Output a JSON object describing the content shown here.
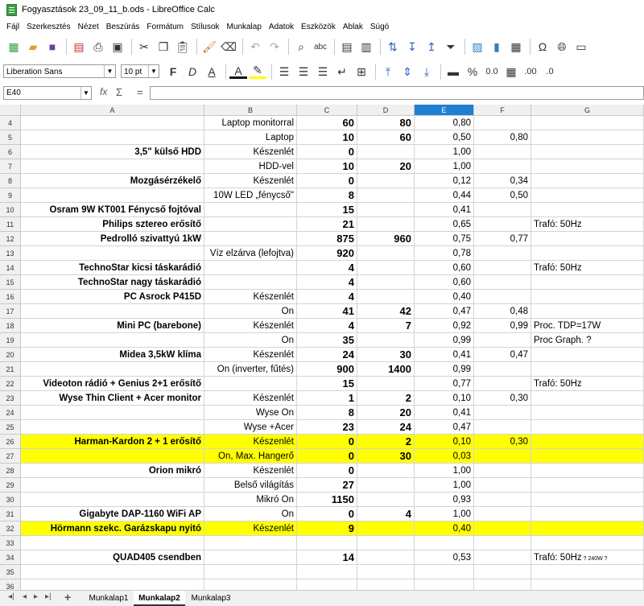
{
  "window": {
    "title": "Fogyasztások 23_09_11_b.ods - LibreOffice Calc"
  },
  "menu": [
    "Fájl",
    "Szerkesztés",
    "Nézet",
    "Beszúrás",
    "Formátum",
    "Stílusok",
    "Munkalap",
    "Adatok",
    "Eszközök",
    "Ablak",
    "Súgó"
  ],
  "format_toolbar": {
    "font_name": "Liberation Sans",
    "font_size": "10 pt"
  },
  "formula_bar": {
    "cell_ref": "E40",
    "value": ""
  },
  "columns": [
    "A",
    "B",
    "C",
    "D",
    "E",
    "F",
    "G"
  ],
  "selected_column": "E",
  "rows": [
    {
      "n": "4",
      "a": "",
      "b": "Laptop monitorral",
      "c": "60",
      "d": "80",
      "e": "0,80",
      "f": "",
      "g": ""
    },
    {
      "n": "5",
      "a": "",
      "b": "Laptop",
      "c": "10",
      "d": "60",
      "e": "0,50",
      "f": "0,80",
      "g": ""
    },
    {
      "n": "6",
      "a": "3,5\" külső HDD",
      "b": "Készenlét",
      "c": "0",
      "d": "",
      "e": "1,00",
      "f": "",
      "g": ""
    },
    {
      "n": "7",
      "a": "",
      "b": "HDD-vel",
      "c": "10",
      "d": "20",
      "e": "1,00",
      "f": "",
      "g": ""
    },
    {
      "n": "8",
      "a": "Mozgásérzékelő",
      "b": "Készenlét",
      "c": "0",
      "d": "",
      "e": "0,12",
      "f": "0,34",
      "g": ""
    },
    {
      "n": "9",
      "a": "",
      "b": "10W LED „fénycső\"",
      "c": "8",
      "d": "",
      "e": "0,44",
      "f": "0,50",
      "g": ""
    },
    {
      "n": "10",
      "a": "Osram 9W KT001 Fénycső fojtóval",
      "b": "",
      "c": "15",
      "d": "",
      "e": "0,41",
      "f": "",
      "g": ""
    },
    {
      "n": "11",
      "a": "Philips sztereo erősítő",
      "b": "",
      "c": "21",
      "d": "",
      "e": "0,65",
      "f": "",
      "g": "Trafó: 50Hz"
    },
    {
      "n": "12",
      "a": "Pedrolló szivattyú 1kW",
      "b": "",
      "c": "875",
      "d": "960",
      "e": "0,75",
      "f": "0,77",
      "g": ""
    },
    {
      "n": "13",
      "a": "",
      "b": "Víz elzárva (lefojtva)",
      "c": "920",
      "d": "",
      "e": "0,78",
      "f": "",
      "g": ""
    },
    {
      "n": "14",
      "a": "TechnoStar kicsi  táskarádió",
      "b": "",
      "c": "4",
      "d": "",
      "e": "0,60",
      "f": "",
      "g": "Trafó: 50Hz"
    },
    {
      "n": "15",
      "a": "TechnoStar nagy táskarádió",
      "b": "",
      "c": "4",
      "d": "",
      "e": "0,60",
      "f": "",
      "g": ""
    },
    {
      "n": "16",
      "a": "PC Asrock P415D",
      "b": "Készenlét",
      "c": "4",
      "d": "",
      "e": "0,40",
      "f": "",
      "g": ""
    },
    {
      "n": "17",
      "a": "",
      "b": "On",
      "c": "41",
      "d": "42",
      "e": "0,47",
      "f": "0,48",
      "g": ""
    },
    {
      "n": "18",
      "a": "Mini PC (barebone)",
      "b": "Készenlét",
      "c": "4",
      "d": "7",
      "e": "0,92",
      "f": "0,99",
      "g": "Proc. TDP=17W"
    },
    {
      "n": "19",
      "a": "",
      "b": "On",
      "c": "35",
      "d": "",
      "e": "0,99",
      "f": "",
      "g": "Proc Graph. ?"
    },
    {
      "n": "20",
      "a": "Midea 3,5kW klíma",
      "b": "Készenlét",
      "c": "24",
      "d": "30",
      "e": "0,41",
      "f": "0,47",
      "g": ""
    },
    {
      "n": "21",
      "a": "",
      "b": "On (inverter, fűtés)",
      "c": "900",
      "d": "1400",
      "e": "0,99",
      "f": "",
      "g": ""
    },
    {
      "n": "22",
      "a": "Videoton rádió + Genius 2+1 erősítő",
      "b": "",
      "c": "15",
      "d": "",
      "e": "0,77",
      "f": "",
      "g": "Trafó: 50Hz"
    },
    {
      "n": "23",
      "a": "Wyse Thin Client + Acer monitor",
      "b": "Készenlét",
      "c": "1",
      "d": "2",
      "e": "0,10",
      "f": "0,30",
      "g": ""
    },
    {
      "n": "24",
      "a": "",
      "b": "Wyse On",
      "c": "8",
      "d": "20",
      "e": "0,41",
      "f": "",
      "g": ""
    },
    {
      "n": "25",
      "a": "",
      "b": "Wyse +Acer",
      "c": "23",
      "d": "24",
      "e": "0,47",
      "f": "",
      "g": ""
    },
    {
      "n": "26",
      "a": "Harman-Kardon 2 + 1 erősítő",
      "b": "Készenlét",
      "c": "0",
      "d": "2",
      "e": "0,10",
      "f": "0,30",
      "g": "",
      "hl": true
    },
    {
      "n": "27",
      "a": "",
      "b": "On, Max. Hangerő",
      "c": "0",
      "d": "30",
      "e": "0,03",
      "f": "",
      "g": "",
      "hl": true
    },
    {
      "n": "28",
      "a": "Orion mikró",
      "b": "Készenlét",
      "c": "0",
      "d": "",
      "e": "1,00",
      "f": "",
      "g": ""
    },
    {
      "n": "29",
      "a": "",
      "b": "Belső világítás",
      "c": "27",
      "d": "",
      "e": "1,00",
      "f": "",
      "g": ""
    },
    {
      "n": "30",
      "a": "",
      "b": "Mikró On",
      "c": "1150",
      "d": "",
      "e": "0,93",
      "f": "",
      "g": ""
    },
    {
      "n": "31",
      "a": "Gigabyte DAP-1160 WiFi AP",
      "b": "On",
      "c": "0",
      "d": "4",
      "e": "1,00",
      "f": "",
      "g": ""
    },
    {
      "n": "32",
      "a": "Hörmann szekc. Garázskapu nyitó",
      "b": "Készenlét",
      "c": "9",
      "d": "",
      "e": "0,40",
      "f": "",
      "g": "",
      "hl": true
    },
    {
      "n": "33",
      "a": "",
      "b": "",
      "c": "",
      "d": "",
      "e": "",
      "f": "",
      "g": ""
    },
    {
      "n": "34",
      "a": "QUAD405 csendben",
      "b": "",
      "c": "14",
      "d": "",
      "e": "0,53",
      "f": "",
      "g": "Trafó: 50Hz",
      "g_small": " ? 240W ?"
    },
    {
      "n": "35",
      "a": "",
      "b": "",
      "c": "",
      "d": "",
      "e": "",
      "f": "",
      "g": ""
    },
    {
      "n": "36",
      "a": "",
      "b": "",
      "c": "",
      "d": "",
      "e": "",
      "f": "",
      "g": ""
    }
  ],
  "sheet_tabs": [
    "Munkalap1",
    "Munkalap2",
    "Munkalap3"
  ],
  "active_tab": "Munkalap2",
  "colors": {
    "highlight": "#ffff00",
    "selected_header": "#1f7fd3"
  }
}
